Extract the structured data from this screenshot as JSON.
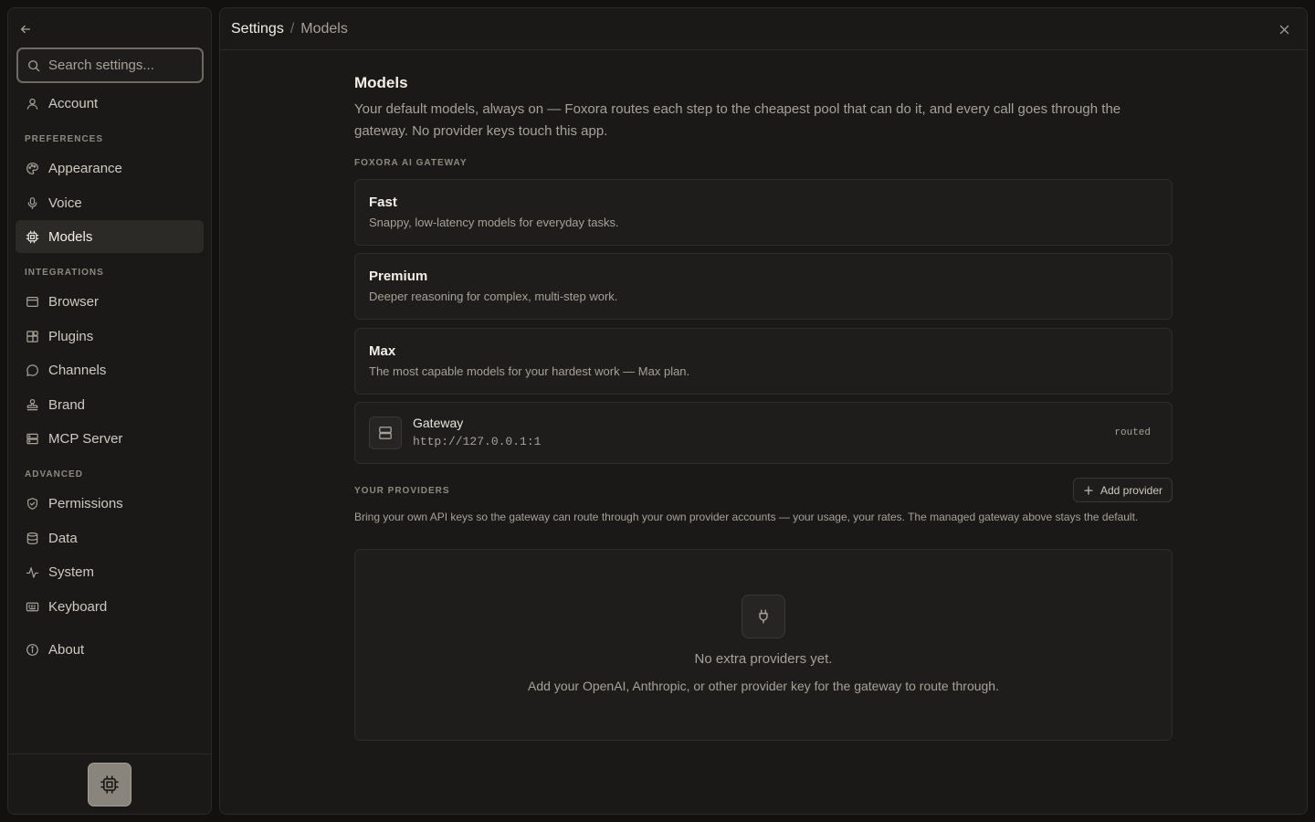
{
  "sidebar": {
    "back_icon": "arrow-left-icon",
    "search": {
      "placeholder": "Search settings...",
      "value": ""
    },
    "account": {
      "label": "Account",
      "icon": "user-icon"
    },
    "sections": {
      "preferences": "PREFERENCES",
      "integrations": "INTEGRATIONS",
      "advanced": "ADVANCED"
    },
    "items": {
      "appearance": {
        "label": "Appearance",
        "icon": "palette-icon"
      },
      "voice": {
        "label": "Voice",
        "icon": "mic-icon"
      },
      "models": {
        "label": "Models",
        "icon": "cpu-icon",
        "active": true
      },
      "browser": {
        "label": "Browser",
        "icon": "browser-window-icon"
      },
      "plugins": {
        "label": "Plugins",
        "icon": "puzzle-icon"
      },
      "channels": {
        "label": "Channels",
        "icon": "chat-bubble-icon"
      },
      "brand": {
        "label": "Brand",
        "icon": "stamp-icon"
      },
      "mcp_server": {
        "label": "MCP Server",
        "icon": "server-icon"
      },
      "permissions": {
        "label": "Permissions",
        "icon": "shield-check-icon"
      },
      "data": {
        "label": "Data",
        "icon": "database-icon"
      },
      "system": {
        "label": "System",
        "icon": "activity-icon"
      },
      "keyboard": {
        "label": "Keyboard",
        "icon": "keyboard-icon"
      },
      "about": {
        "label": "About",
        "icon": "info-icon"
      }
    },
    "footer_icon": "cpu-chip-icon"
  },
  "header": {
    "root": "Settings",
    "separator": "/",
    "page": "Models",
    "close_icon": "close-icon"
  },
  "main": {
    "title": "Models",
    "description": "Your default models, always on — Foxora routes each step to the cheapest pool that can do it, and every call goes through the gateway. No provider keys touch this app.",
    "gateway_caption": "FOXORA AI GATEWAY",
    "tiers": [
      {
        "name": "Fast",
        "description": "Snappy, low-latency models for everyday tasks."
      },
      {
        "name": "Premium",
        "description": "Deeper reasoning for complex, multi-step work."
      },
      {
        "name": "Max",
        "description": "The most capable models for your hardest work — Max plan."
      }
    ],
    "gateway": {
      "title": "Gateway",
      "url": "http://127.0.0.1:1",
      "badge": "routed",
      "icon": "server-icon"
    },
    "providers": {
      "caption": "YOUR PROVIDERS",
      "add_label": "Add provider",
      "add_icon": "plus-icon",
      "description": "Bring your own API keys so the gateway can route through your own provider accounts — your usage, your rates. The managed gateway above stays the default.",
      "empty_icon": "plug-icon",
      "empty_title": "No extra providers yet.",
      "empty_subtitle": "Add your OpenAI, Anthropic, or other provider key for the gateway to route through."
    }
  }
}
